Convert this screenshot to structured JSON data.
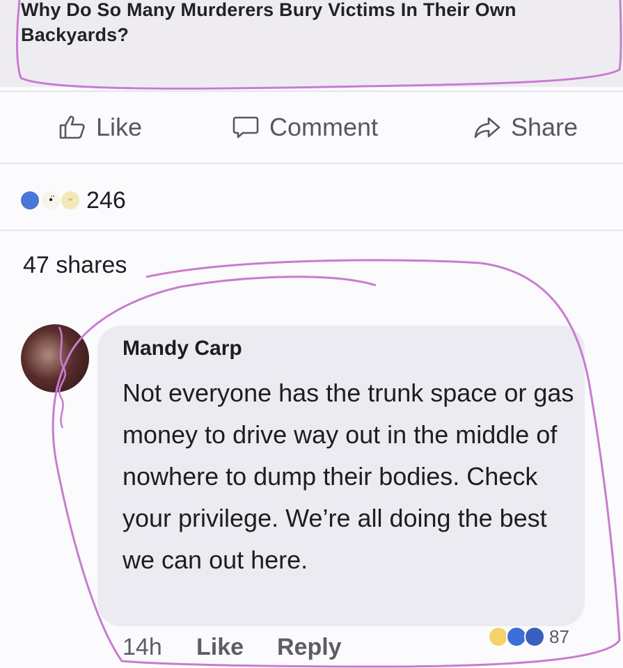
{
  "post": {
    "headline": "Why Do So Many Murderers Bury Victims In Their Own Backyards?"
  },
  "actions": {
    "like": "Like",
    "comment": "Comment",
    "share": "Share"
  },
  "stats": {
    "reaction_count": "246",
    "shares": "47 shares"
  },
  "comment": {
    "author": "Mandy Carp",
    "text": "Not everyone has the trunk space or gas money to drive way out in the middle of nowhere to dump their bodies. Check your privilege. We’re all doing the best we can out here.",
    "time": "14h",
    "like_label": "Like",
    "reply_label": "Reply",
    "reaction_count": "87"
  },
  "colors": {
    "annotation": "#c97bd2",
    "like_blue": "#4a76d8",
    "text": "#1c1e21",
    "muted": "#5b5e63"
  }
}
